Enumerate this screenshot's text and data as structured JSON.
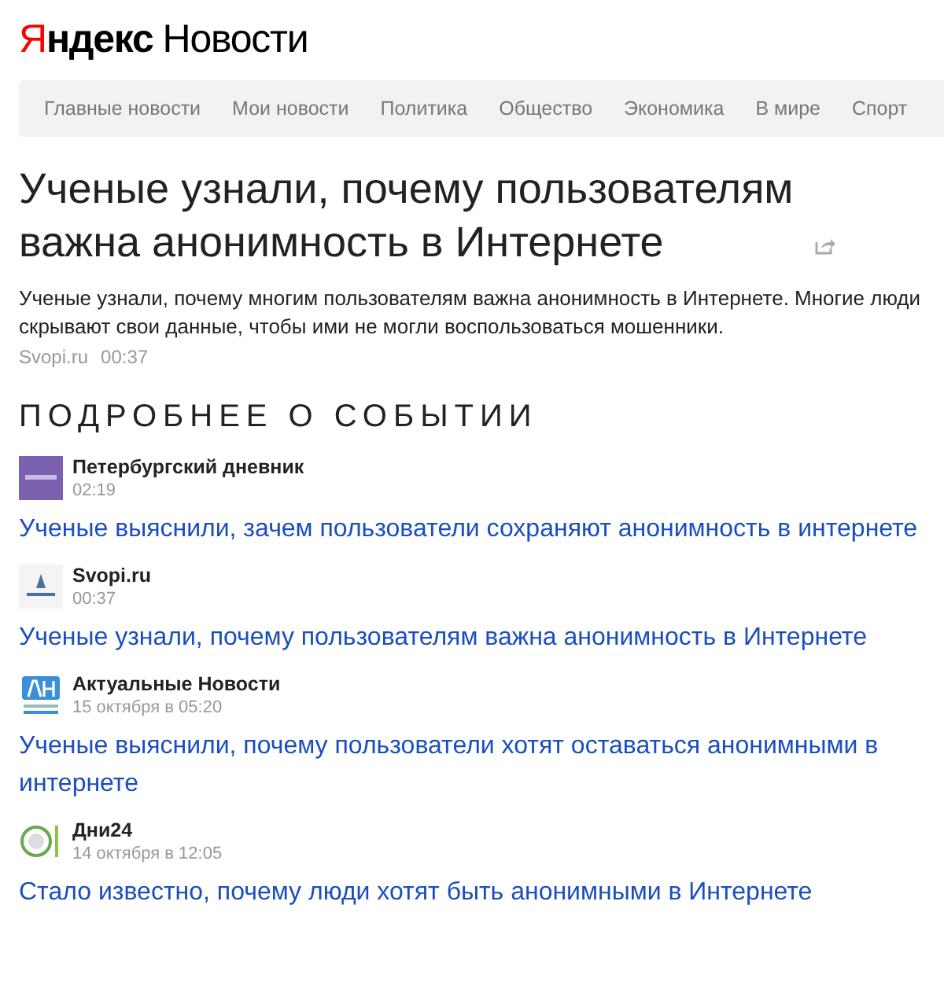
{
  "logo": {
    "brand_first": "Я",
    "brand_rest": "ндекс",
    "service": "Новости"
  },
  "nav": [
    {
      "label": "Главные новости"
    },
    {
      "label": "Мои новости"
    },
    {
      "label": "Политика"
    },
    {
      "label": "Общество"
    },
    {
      "label": "Экономика"
    },
    {
      "label": "В мире"
    },
    {
      "label": "Спорт"
    }
  ],
  "article": {
    "title": "Ученые узнали, почему пользователям важна анонимность в Интернете",
    "summary": "Ученые узнали, почему многим пользователям важна анонимность в Интернете. Многие люди скрывают свои данные, чтобы ими не могли воспользоваться мошенники.",
    "source": "Svopi.ru",
    "time": "00:37"
  },
  "section_title": "ПОДРОБНЕЕ О СОБЫТИИ",
  "stories": [
    {
      "kind": "purple",
      "source": "Петербургский дневник",
      "time": "02:19",
      "headline": "Ученые выяснили, зачем пользователи сохраняют анонимность в интернете"
    },
    {
      "kind": "svopi",
      "source": "Svopi.ru",
      "time": "00:37",
      "headline": "Ученые узнали, почему пользователям важна анонимность в Интернете"
    },
    {
      "kind": "an",
      "source": "Актуальные Новости",
      "time": "15 октября в 05:20",
      "headline": "Ученые выяснили, почему пользователи хотят оставаться анонимными в интернете"
    },
    {
      "kind": "dni",
      "source": "Дни24",
      "time": "14 октября в 12:05",
      "headline": "Стало известно, почему люди хотят быть анонимными в Интернете"
    }
  ]
}
